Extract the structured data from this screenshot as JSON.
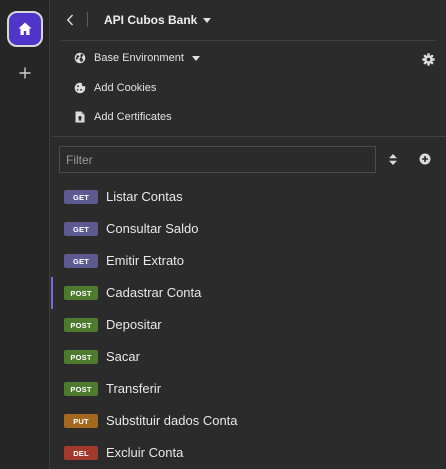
{
  "header": {
    "title": "API Cubos Bank"
  },
  "environment": {
    "label": "Base Environment"
  },
  "menu": {
    "add_cookies": "Add Cookies",
    "add_certificates": "Add Certificates"
  },
  "filter": {
    "placeholder": "Filter",
    "value": ""
  },
  "requests": [
    {
      "method": "GET",
      "name": "Listar Contas",
      "color": "#5d5a91",
      "active": false
    },
    {
      "method": "GET",
      "name": "Consultar Saldo",
      "color": "#5d5a91",
      "active": false
    },
    {
      "method": "GET",
      "name": "Emitir Extrato",
      "color": "#5d5a91",
      "active": false
    },
    {
      "method": "POST",
      "name": "Cadastrar Conta",
      "color": "#4e7a2f",
      "active": true
    },
    {
      "method": "POST",
      "name": "Depositar",
      "color": "#4e7a2f",
      "active": false
    },
    {
      "method": "POST",
      "name": "Sacar",
      "color": "#4e7a2f",
      "active": false
    },
    {
      "method": "POST",
      "name": "Transferir",
      "color": "#4e7a2f",
      "active": false
    },
    {
      "method": "PUT",
      "name": "Substituir dados Conta",
      "color": "#a5681f",
      "active": false
    },
    {
      "method": "DEL",
      "name": "Excluir Conta",
      "color": "#a13a2d",
      "active": false
    }
  ],
  "colors": {
    "accent": "#4f35c9",
    "active_indicator": "#7e6ad6"
  }
}
